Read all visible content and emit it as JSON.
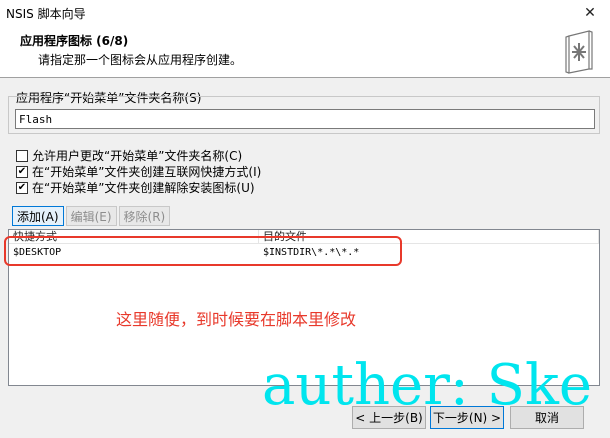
{
  "window": {
    "title": "NSIS 脚本向导",
    "close_glyph": "✕"
  },
  "header": {
    "title": "应用程序图标 (6/8)",
    "subtitle": "请指定那一个图标会从应用程序创建。",
    "icon": "wizard-book-icon"
  },
  "start_menu_group": {
    "legend": "应用程序“开始菜单”文件夹名称(S)",
    "value": "Flash"
  },
  "options": [
    {
      "label": "允许用户更改“开始菜单”文件夹名称(C)",
      "checked": false,
      "mark": ""
    },
    {
      "label": "在“开始菜单”文件夹创建互联网快捷方式(I)",
      "checked": true,
      "mark": "✔"
    },
    {
      "label": "在“开始菜单”文件夹创建解除安装图标(U)",
      "checked": true,
      "mark": "✔"
    }
  ],
  "tabs": [
    {
      "label": "添加(A)",
      "enabled": true
    },
    {
      "label": "编辑(E)",
      "enabled": false
    },
    {
      "label": "移除(R)",
      "enabled": false
    }
  ],
  "shortcut_table": {
    "columns": [
      "快捷方式",
      "目的文件"
    ],
    "rows": [
      [
        "$DESKTOP",
        "$INSTDIR\\*.*\\*.*"
      ]
    ]
  },
  "annotation": {
    "text": "这里随便，到时候要在脚本里修改",
    "color": "#e8392b"
  },
  "watermark": {
    "text": "auther: Ske",
    "color": "#00e5ee"
  },
  "buttons": {
    "back": "< 上一步(B)",
    "next": "下一步(N) >",
    "cancel": "取消"
  }
}
